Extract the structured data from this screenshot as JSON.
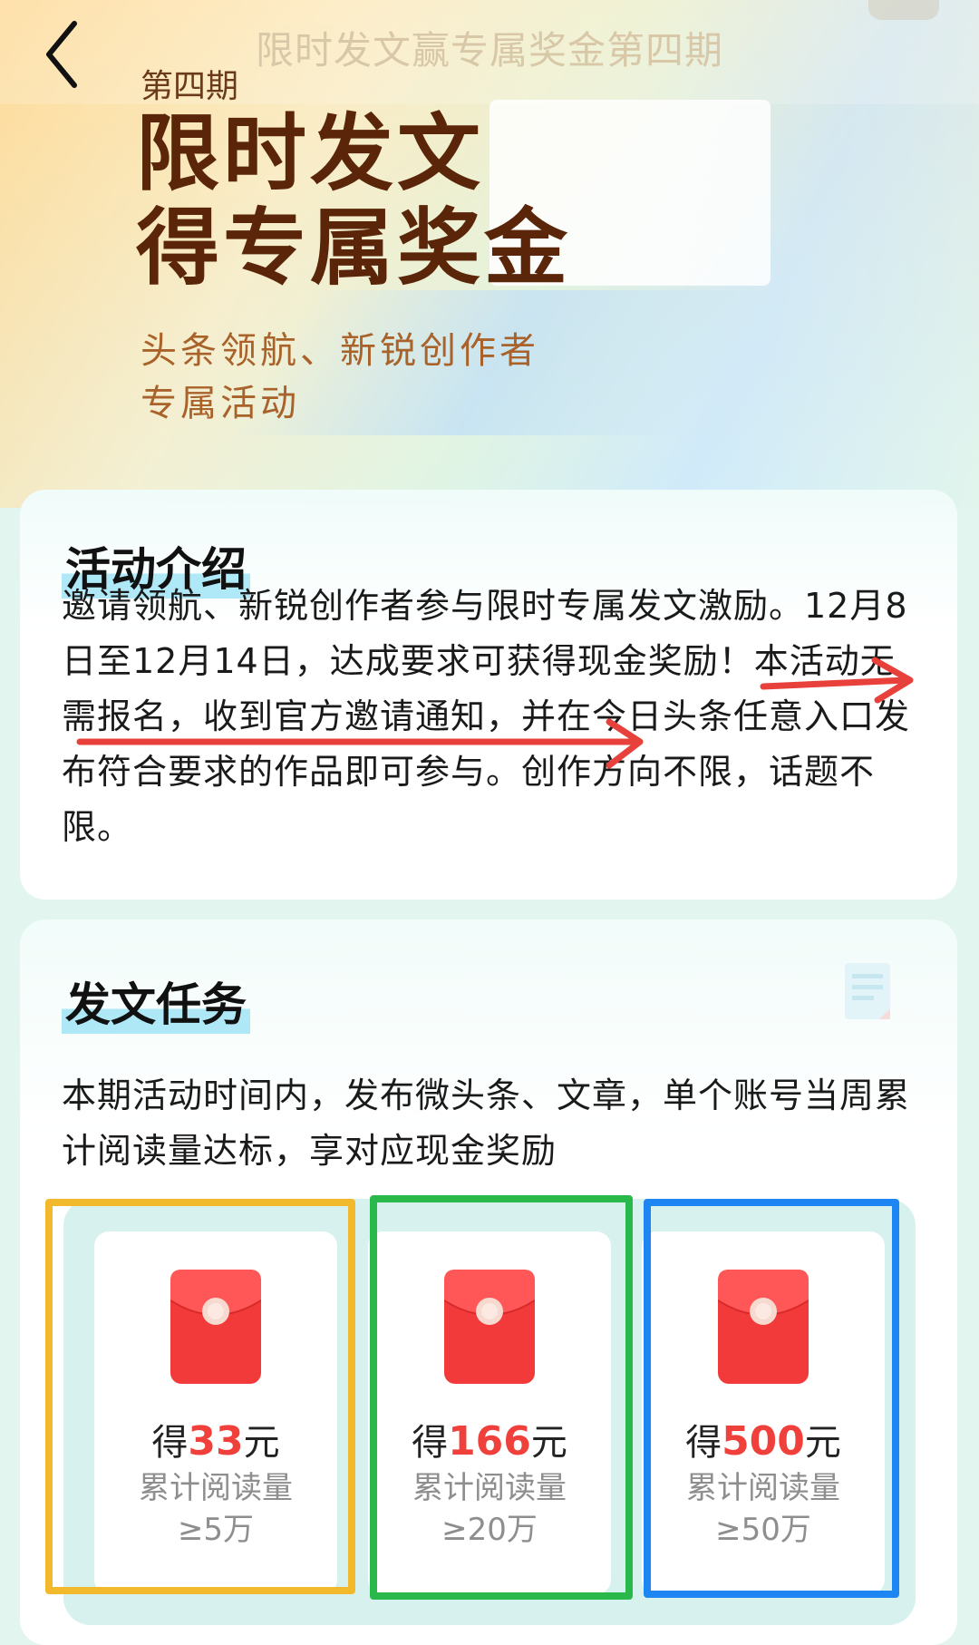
{
  "nav": {
    "title": "限时发文赢专属奖金第四期"
  },
  "hero": {
    "issue": "第四期",
    "title_line1": "限时发文",
    "title_line2": "得专属奖金",
    "subtitle_line1": "头条领航、新锐创作者",
    "subtitle_line2": "专属活动"
  },
  "intro": {
    "title": "活动介绍",
    "text": "邀请领航、新锐创作者参与限时专属发文激励。12月8日至12月14日，达成要求可获得现金奖励！本活动无需报名，收到官方邀请通知，并在今日头条任意入口发布符合要求的作品即可参与。创作方向不限，话题不限。"
  },
  "task": {
    "title": "发文任务",
    "text": "本期活动时间内，发布微头条、文章，单个账号当周累计阅读量达标，享对应现金奖励",
    "rewards": [
      {
        "prefix": "得",
        "amount": "33",
        "unit": "元",
        "desc_line1": "累计阅读量",
        "desc_line2": "≥5万",
        "frame_color": "#f2b92c"
      },
      {
        "prefix": "得",
        "amount": "166",
        "unit": "元",
        "desc_line1": "累计阅读量",
        "desc_line2": "≥20万",
        "frame_color": "#2bb84a"
      },
      {
        "prefix": "得",
        "amount": "500",
        "unit": "元",
        "desc_line1": "累计阅读量",
        "desc_line2": "≥50万",
        "frame_color": "#1e86f2"
      }
    ]
  },
  "icons": {
    "back": "chevron-left-icon",
    "doc": "document-icon",
    "red_packet": "red-envelope-icon"
  },
  "colors": {
    "hero_title": "#5a2508",
    "hero_subtitle": "#a8622a",
    "amount": "#f0403c",
    "annotation_arrow": "#e8403a"
  }
}
